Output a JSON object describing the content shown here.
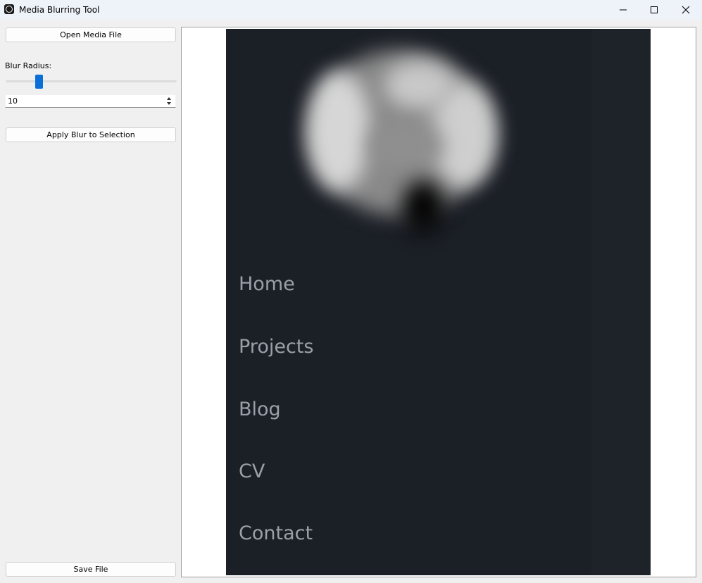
{
  "window": {
    "title": "Media Blurring Tool"
  },
  "controls": {
    "open_label": "Open Media File",
    "blur_radius_label": "Blur Radius:",
    "blur_radius_value": "10",
    "apply_label": "Apply Blur to Selection",
    "save_label": "Save File"
  },
  "preview": {
    "nav_items": [
      "Home",
      "Projects",
      "Blog",
      "CV",
      "Contact"
    ]
  },
  "colors": {
    "accent": "#0a6fd6",
    "media_background": "#1b1f26",
    "nav_text": "#9aa0a9"
  }
}
